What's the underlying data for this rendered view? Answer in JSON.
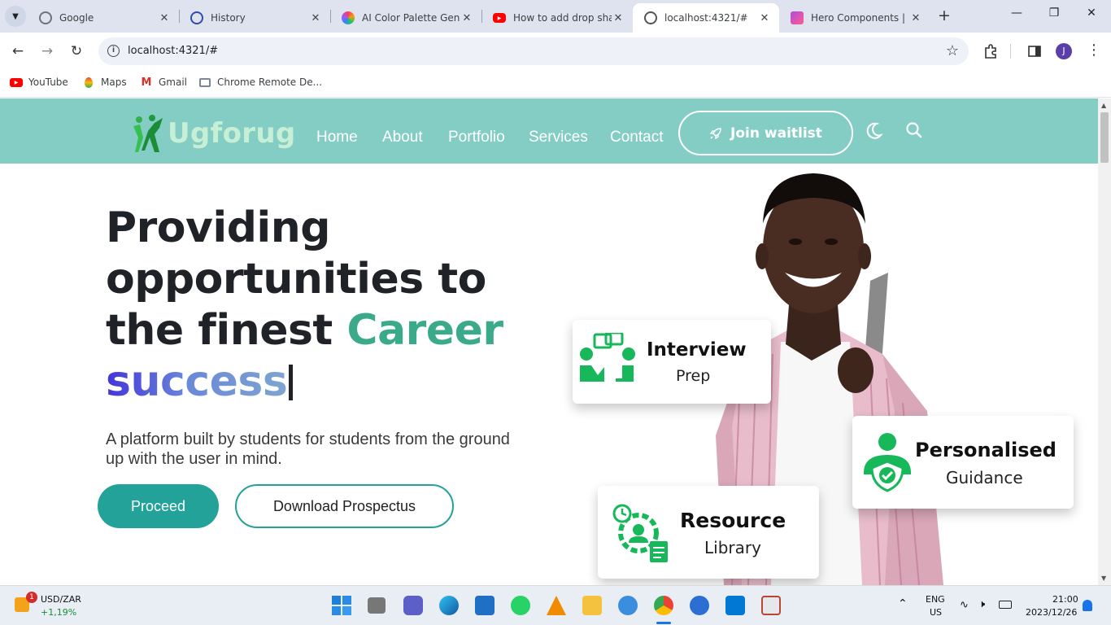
{
  "browser": {
    "tabs": [
      {
        "title": "Google",
        "icon": "google-icon",
        "active": false
      },
      {
        "title": "History",
        "icon": "history-icon",
        "active": false
      },
      {
        "title": "AI Color Palette Gene",
        "icon": "palette-icon",
        "active": false
      },
      {
        "title": "How to add drop sha",
        "icon": "youtube-icon",
        "active": false
      },
      {
        "title": "localhost:4321/#",
        "icon": "globe-icon",
        "active": true
      },
      {
        "title": "Hero Components | L",
        "icon": "astro-icon",
        "active": false
      }
    ],
    "url": "localhost:4321/#",
    "profile_initial": "J",
    "bookmarks": [
      {
        "label": "YouTube",
        "icon": "youtube-icon"
      },
      {
        "label": "Maps",
        "icon": "maps-icon"
      },
      {
        "label": "Gmail",
        "icon": "gmail-icon"
      },
      {
        "label": "Chrome Remote De...",
        "icon": "remote-desktop-icon"
      }
    ]
  },
  "site": {
    "logo_text": "Ugforug",
    "nav": [
      "Home",
      "About",
      "Portfolio",
      "Services",
      "Contact"
    ],
    "cta": "Join waitlist",
    "hero": {
      "line1": "Providing",
      "line2": "opportunities to",
      "line3_prefix": "the finest ",
      "line3_highlight": "Career",
      "line4": "success"
    },
    "subtitle": "A platform built by students for students from the ground up with the user in mind.",
    "primary_button": "Proceed",
    "secondary_button": "Download Prospectus",
    "cards": {
      "interview": {
        "title": "Interview",
        "sub": "Prep"
      },
      "guidance": {
        "title": "Personalised",
        "sub": "Guidance"
      },
      "library": {
        "title": "Resource",
        "sub": "Library"
      }
    },
    "colors": {
      "nav_bg": "#83cdc5",
      "primary": "#23a29a",
      "career": "#3aaa8b",
      "card_icon": "#16b85a"
    }
  },
  "taskbar": {
    "widget_label": "USD/ZAR",
    "widget_value": "+1,19%",
    "widget_badge": "1",
    "lang_line1": "ENG",
    "lang_line2": "US",
    "time": "21:00",
    "date": "2023/12/26"
  }
}
